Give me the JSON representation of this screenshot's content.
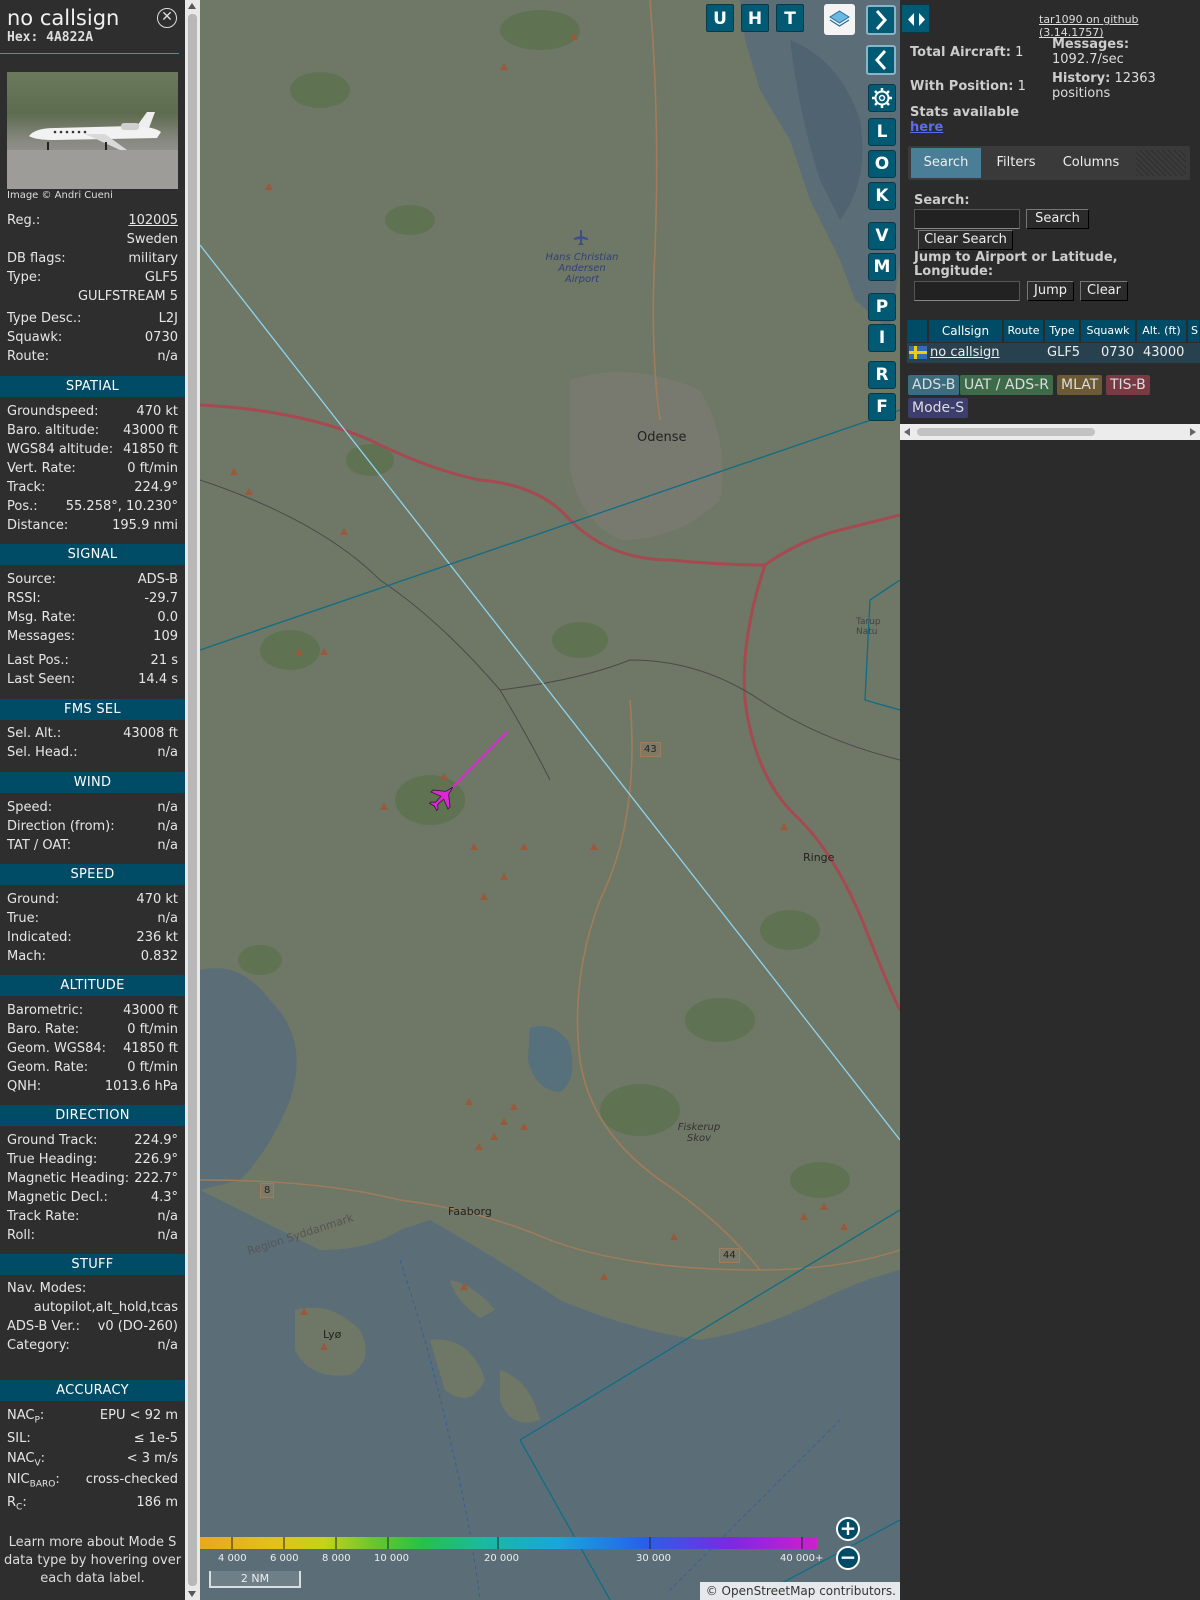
{
  "infoblock": {
    "callsign": "no callsign",
    "hex": "Hex: 4A822A",
    "photo_credit": "Image © Andri Cueni",
    "reg_label": "Reg.:",
    "reg_value": "102005",
    "country": "Sweden",
    "dbflags_label": "DB flags:",
    "dbflags_value": "military",
    "type_label": "Type:",
    "type_value": "GLF5",
    "type_name": "GULFSTREAM 5",
    "typedesc_label": "Type Desc.:",
    "typedesc_value": "L2J",
    "squawk_label": "Squawk:",
    "squawk_value": "0730",
    "route_label": "Route:",
    "route_value": "n/a",
    "sections": {
      "spatial": "SPATIAL",
      "signal": "SIGNAL",
      "fms": "FMS SEL",
      "wind": "WIND",
      "speed": "SPEED",
      "altitude": "ALTITUDE",
      "direction": "DIRECTION",
      "stuff": "STUFF",
      "accuracy": "ACCURACY"
    },
    "spatial": [
      {
        "label": "Groundspeed:",
        "value": "470 kt"
      },
      {
        "label": "Baro. altitude:",
        "value": "43000 ft"
      },
      {
        "label": "WGS84 altitude:",
        "value": "41850 ft"
      },
      {
        "label": "Vert. Rate:",
        "value": "0 ft/min"
      },
      {
        "label": "Track:",
        "value": "224.9°"
      },
      {
        "label": "Pos.:",
        "value": "55.258°, 10.230°"
      },
      {
        "label": "Distance:",
        "value": "195.9 nmi"
      }
    ],
    "signal": [
      {
        "label": "Source:",
        "value": "ADS-B"
      },
      {
        "label": "RSSI:",
        "value": "-29.7"
      },
      {
        "label": "Msg. Rate:",
        "value": "0.0"
      },
      {
        "label": "Messages:",
        "value": "109"
      },
      {
        "label": "Last Pos.:",
        "value": "21 s"
      },
      {
        "label": "Last Seen:",
        "value": "14.4 s"
      }
    ],
    "fms": [
      {
        "label": "Sel. Alt.:",
        "value": "43008 ft"
      },
      {
        "label": "Sel. Head.:",
        "value": "n/a"
      }
    ],
    "wind": [
      {
        "label": "Speed:",
        "value": "n/a"
      },
      {
        "label": "Direction (from):",
        "value": "n/a"
      },
      {
        "label": "TAT / OAT:",
        "value": "n/a"
      }
    ],
    "speed": [
      {
        "label": "Ground:",
        "value": "470 kt"
      },
      {
        "label": "True:",
        "value": "n/a"
      },
      {
        "label": "Indicated:",
        "value": "236 kt"
      },
      {
        "label": "Mach:",
        "value": "0.832"
      }
    ],
    "altitude": [
      {
        "label": "Barometric:",
        "value": "43000 ft"
      },
      {
        "label": "Baro. Rate:",
        "value": "0 ft/min"
      },
      {
        "label": "Geom. WGS84:",
        "value": "41850 ft"
      },
      {
        "label": "Geom. Rate:",
        "value": "0 ft/min"
      },
      {
        "label": "QNH:",
        "value": "1013.6 hPa"
      }
    ],
    "direction": [
      {
        "label": "Ground Track:",
        "value": "224.9°"
      },
      {
        "label": "True Heading:",
        "value": "226.9°"
      },
      {
        "label": "Magnetic Heading:",
        "value": "222.7°"
      },
      {
        "label": "Magnetic Decl.:",
        "value": "4.3°"
      },
      {
        "label": "Track Rate:",
        "value": "n/a"
      },
      {
        "label": "Roll:",
        "value": "n/a"
      }
    ],
    "stuff": {
      "navmodes_label": "Nav. Modes:",
      "navmodes_value": "autopilot,alt_hold,tcas",
      "adsbver_label": "ADS-B Ver.:",
      "adsbver_value": "v0 (DO-260)",
      "category_label": "Category:",
      "category_value": "n/a"
    },
    "accuracy": {
      "nacp_label": "NAC",
      "nacp_sub": "P",
      "nacp_value": "EPU < 92 m",
      "sil_label": "SIL:",
      "sil_value": "≤ 1e-5",
      "nacv_label": "NAC",
      "nacv_sub": "V",
      "nacv_value": "< 3 m/s",
      "nicbaro_label": "NIC",
      "nicbaro_sub": "BARO",
      "nicbaro_value": "cross-checked",
      "rc_label": "R",
      "rc_sub": "C",
      "rc_value": "186 m"
    },
    "learn_more": "Learn more about Mode S data type by hovering over each data label."
  },
  "map": {
    "top_buttons": [
      "U",
      "H",
      "T"
    ],
    "side_buttons": [
      "L",
      "O",
      "K",
      "V",
      "M",
      "P",
      "I",
      "R",
      "F"
    ],
    "place_labels": {
      "odense": "Odense",
      "ringe": "Ringe",
      "faaborg": "Faaborg",
      "lyo": "Lyø",
      "airport": "Hans Christian Andersen Airport",
      "fiskerup": "Fiskerup Skov",
      "region": "Region Syddanmark",
      "tarup": "Tarup Natu",
      "road43": "43",
      "road44": "44",
      "road8": "8"
    },
    "colorbar_labels": [
      "4 000",
      "6 000",
      "8 000",
      "10 000",
      "20 000",
      "30 000",
      "40 000+"
    ],
    "scale_label": "2 NM",
    "attribution": "© OpenStreetMap contributors.",
    "zoom_in": "+",
    "zoom_out": "−"
  },
  "sidebar": {
    "github_link": "tar1090 on github (3.14.1757)",
    "total_aircraft_label": "Total Aircraft:",
    "total_aircraft": "1",
    "with_position_label": "With Position:",
    "with_position": "1",
    "messages_label": "Messages:",
    "messages_value": "1092.7/sec",
    "history_label": "History:",
    "history_value": "12363 positions",
    "stats_label": "Stats available",
    "stats_link": "here",
    "tabs": [
      "Search",
      "Filters",
      "Columns"
    ],
    "search_label": "Search:",
    "search_button": "Search",
    "clear_search_button": "Clear Search",
    "jump_label": "Jump to Airport or Latitude, Longitude:",
    "jump_button": "Jump",
    "clear_button": "Clear",
    "table": {
      "headers": [
        "Callsign",
        "Route",
        "Type",
        "Squawk",
        "Alt. (ft)",
        "S"
      ],
      "row": {
        "callsign": "no callsign",
        "route": "",
        "type": "GLF5",
        "squawk": "0730",
        "alt": "43000"
      }
    },
    "legend": [
      {
        "label": "ADS-B",
        "color": "#3c6d7e"
      },
      {
        "label": "UAT / ADS-R",
        "color": "#3d6b4a"
      },
      {
        "label": "MLAT",
        "color": "#6b5a34"
      },
      {
        "label": "TIS-B",
        "color": "#7a3a44"
      },
      {
        "label": "Mode-S",
        "color": "#3d3d6e"
      }
    ]
  }
}
